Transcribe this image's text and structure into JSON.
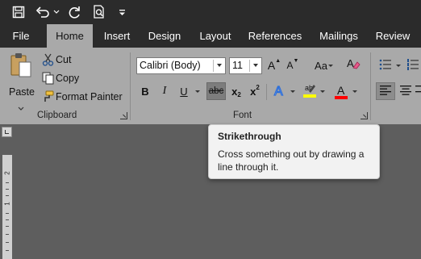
{
  "qat": {
    "icons": [
      "save-icon",
      "undo-icon",
      "undo-dropdown-icon",
      "redo-icon",
      "print-preview-icon",
      "customize-qat-icon"
    ]
  },
  "tabs": [
    {
      "label": "File"
    },
    {
      "label": "Home",
      "active": true
    },
    {
      "label": "Insert"
    },
    {
      "label": "Design"
    },
    {
      "label": "Layout"
    },
    {
      "label": "References"
    },
    {
      "label": "Mailings"
    },
    {
      "label": "Review"
    }
  ],
  "clipboard": {
    "paste_label": "Paste",
    "cut_label": "Cut",
    "copy_label": "Copy",
    "format_painter_label": "Format Painter",
    "group_label": "Clipboard"
  },
  "font": {
    "font_name": "Calibri (Body)",
    "font_size": "11",
    "grow_label": "A",
    "shrink_label": "A",
    "change_case_label": "Aa",
    "bold_label": "B",
    "italic_label": "I",
    "underline_label": "U",
    "strikethrough_label": "abc",
    "subscript_label": "x",
    "subscript_sub": "2",
    "superscript_label": "x",
    "superscript_sup": "2",
    "font_color_label": "A",
    "group_label": "Font"
  },
  "colors": {
    "highlight": "#ffff00",
    "font_color": "#ff0000",
    "accent_blue": "#2e6fd8",
    "tab_active_bg": "#a9a9a9",
    "titlebar_bg": "#2b2b2b"
  },
  "tooltip": {
    "title": "Strikethrough",
    "description": "Cross something out by drawing a line through it."
  },
  "ruler": {
    "labels": [
      "2",
      "1"
    ]
  }
}
